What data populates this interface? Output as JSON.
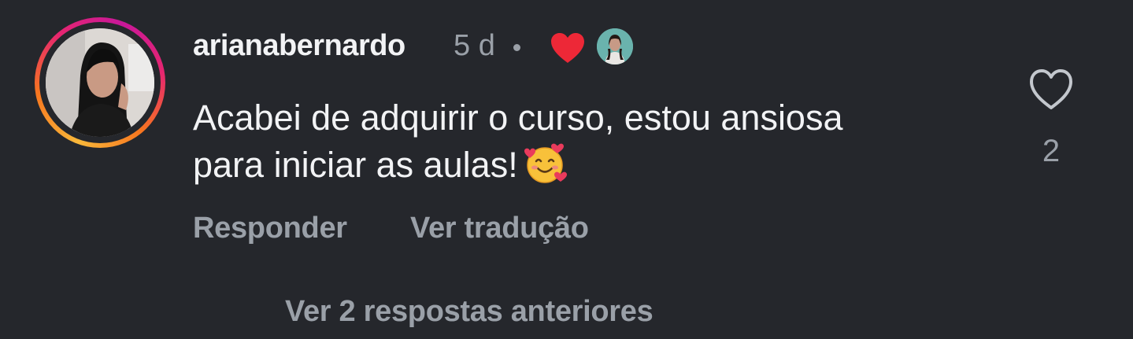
{
  "comment": {
    "username": "arianabernardo",
    "time_ago": "5 d",
    "separator": "•",
    "author_liked": true,
    "text_line1": "Acabei de adquirir o curso, estou ansiosa",
    "text_line2": "para iniciar as aulas!",
    "emoji_icon": "smiling-face-with-hearts-icon",
    "like_count": "2",
    "actions": {
      "reply_label": "Responder",
      "translate_label": "Ver tradução"
    }
  },
  "replies": {
    "view_label": "Ver 2 respostas anteriores"
  },
  "colors": {
    "background": "#25272c",
    "primary_text": "#f2f3f5",
    "secondary_text": "#9aa0a8",
    "heart_red": "#ed2837",
    "story_ring_start": "#f9b83a",
    "story_ring_end": "#c8189a"
  }
}
